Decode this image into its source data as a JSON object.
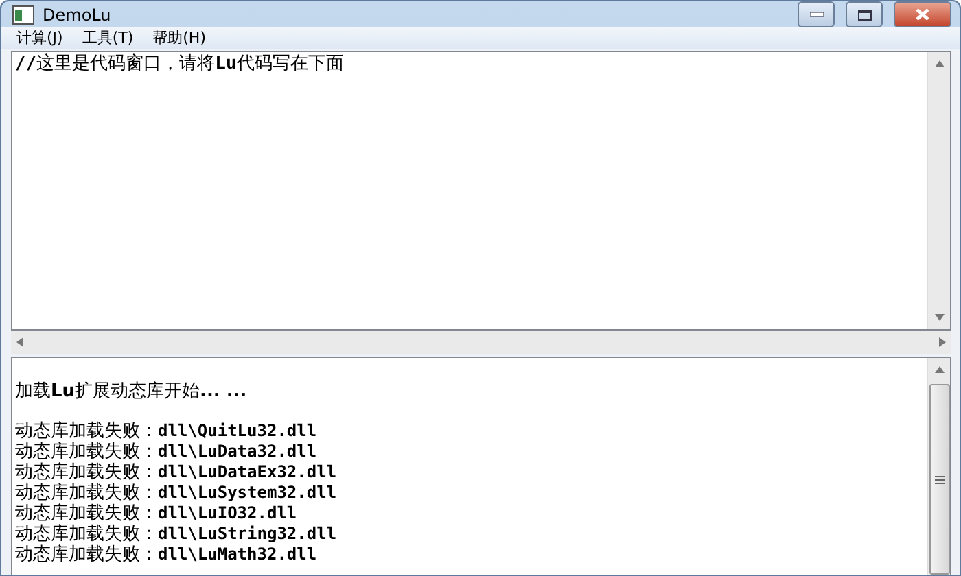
{
  "window": {
    "title": "DemoLu"
  },
  "menu": [
    {
      "label": "计算(J)"
    },
    {
      "label": "工具(T)"
    },
    {
      "label": "帮助(H)"
    }
  ],
  "editor": {
    "value": "**//**这里是代码窗口，请将**Lu**代码写在下面"
  },
  "output": {
    "header": "加载**Lu**扩展动态库开始**... ...**",
    "lines": [
      {
        "label": "动态库加载失败：",
        "path": "dll\\QuitLu32.dll"
      },
      {
        "label": "动态库加载失败：",
        "path": "dll\\LuData32.dll"
      },
      {
        "label": "动态库加载失败：",
        "path": "dll\\LuDataEx32.dll"
      },
      {
        "label": "动态库加载失败：",
        "path": "dll\\LuSystem32.dll"
      },
      {
        "label": "动态库加载失败：",
        "path": "dll\\LuIO32.dll"
      },
      {
        "label": "动态库加载失败：",
        "path": "dll\\LuString32.dll"
      },
      {
        "label": "动态库加载失败：",
        "path": "dll\\LuMath32.dll"
      }
    ]
  }
}
